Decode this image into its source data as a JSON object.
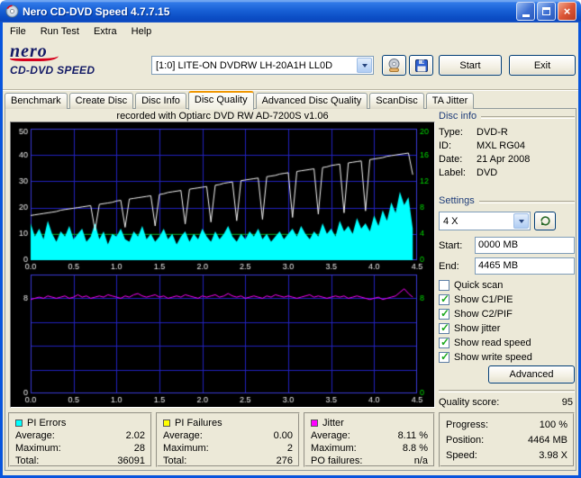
{
  "window": {
    "title": "Nero CD-DVD Speed 4.7.7.15"
  },
  "icons": {
    "close": "×",
    "minimize": "underscore-bar",
    "maximize": "square",
    "dropdown-arrow": "▼",
    "check": "✓",
    "disc": "css-disc-shape",
    "save": "css-floppy-shape",
    "reload": "circular-arrow"
  },
  "menu": {
    "items": [
      "File",
      "Run Test",
      "Extra",
      "Help"
    ]
  },
  "header": {
    "logo_line1": "nero",
    "logo_line2": "CD-DVD SPEED",
    "drive_selected": "[1:0]  LITE-ON DVDRW LH-20A1H LL0D",
    "start_button": "Start",
    "exit_button": "Exit"
  },
  "tabs": {
    "items": [
      "Benchmark",
      "Create Disc",
      "Disc Info",
      "Disc Quality",
      "Advanced Disc Quality",
      "ScanDisc",
      "TA Jitter"
    ],
    "selected": "Disc Quality"
  },
  "chart_data": [
    {
      "name": "Disc quality scan",
      "type": "area+line",
      "annotation": "recorded with Optiarc DVD RW AD-7200S  v1.06",
      "xlim": [
        0,
        4.5
      ],
      "x_unit": "GB",
      "x_ticks": [
        "0.0",
        "0.5",
        "1.0",
        "1.5",
        "2.0",
        "2.5",
        "3.0",
        "3.5",
        "4.0",
        "4.5"
      ],
      "x_grid_step": 0.5,
      "grid_y": [
        10,
        20,
        30,
        40
      ],
      "left_axis": {
        "lim": [
          0,
          50
        ],
        "ticks": [
          0,
          10,
          20,
          30,
          40,
          50
        ]
      },
      "right_axis": {
        "lim": [
          0,
          20
        ],
        "ticks": [
          0,
          4,
          8,
          12,
          16,
          20
        ]
      },
      "x": [
        0,
        0.05,
        0.1,
        0.15,
        0.2,
        0.25,
        0.3,
        0.35,
        0.4,
        0.45,
        0.5,
        0.55,
        0.6,
        0.65,
        0.7,
        0.75,
        0.8,
        0.85,
        0.9,
        0.95,
        1,
        1.05,
        1.1,
        1.15,
        1.2,
        1.25,
        1.3,
        1.35,
        1.4,
        1.45,
        1.5,
        1.55,
        1.6,
        1.65,
        1.7,
        1.75,
        1.8,
        1.85,
        1.9,
        1.95,
        2,
        2.05,
        2.1,
        2.15,
        2.2,
        2.25,
        2.3,
        2.35,
        2.4,
        2.45,
        2.5,
        2.55,
        2.6,
        2.65,
        2.7,
        2.75,
        2.8,
        2.85,
        2.9,
        2.95,
        3,
        3.05,
        3.1,
        3.15,
        3.2,
        3.25,
        3.3,
        3.35,
        3.4,
        3.45,
        3.5,
        3.55,
        3.6,
        3.65,
        3.7,
        3.75,
        3.8,
        3.85,
        3.9,
        3.95,
        4,
        4.05,
        4.1,
        4.15,
        4.2,
        4.25,
        4.3,
        4.35,
        4.4,
        4.45
      ],
      "series": [
        {
          "name": "Read speed",
          "type": "line",
          "axis": "right",
          "color": "#00B400",
          "constant": 4
        },
        {
          "name": "PI Errors",
          "type": "area",
          "axis": "left",
          "color": "#00FFFF",
          "values": [
            14,
            9,
            12,
            8,
            15,
            10,
            7,
            11,
            9,
            13,
            8,
            10,
            12,
            7,
            9,
            14,
            8,
            11,
            6,
            10,
            9,
            12,
            8,
            7,
            11,
            9,
            13,
            8,
            10,
            7,
            9,
            12,
            8,
            10,
            6,
            9,
            11,
            7,
            10,
            8,
            12,
            9,
            7,
            11,
            8,
            10,
            13,
            9,
            7,
            10,
            8,
            11,
            9,
            12,
            8,
            10,
            7,
            9,
            11,
            8,
            10,
            12,
            9,
            13,
            10,
            8,
            11,
            9,
            14,
            10,
            12,
            9,
            15,
            11,
            13,
            10,
            16,
            12,
            14,
            11,
            17,
            13,
            19,
            15,
            22,
            18,
            26,
            21,
            24,
            12
          ]
        },
        {
          "name": "Write speed",
          "type": "line",
          "axis": "right",
          "color": "#F5F5F5",
          "values": [
            6.8,
            6.9,
            7,
            7.1,
            7.2,
            7.3,
            7.4,
            7.6,
            7.7,
            7.8,
            7.9,
            8,
            8.1,
            8.2,
            8.3,
            4.5,
            8.5,
            8.6,
            8.7,
            8.8,
            9,
            9.1,
            5,
            9.3,
            9.4,
            9.5,
            9.6,
            9.7,
            9.8,
            5.2,
            10,
            10.1,
            10.3,
            10.4,
            10.5,
            10.6,
            5.5,
            10.8,
            10.9,
            11,
            11.1,
            11.2,
            5.8,
            11.4,
            11.5,
            11.7,
            11.8,
            11.9,
            6,
            12.1,
            12.2,
            12.3,
            12.4,
            12.5,
            6.2,
            12.7,
            12.8,
            12.9,
            13.1,
            13.2,
            13.3,
            6.5,
            13.5,
            13.6,
            13.7,
            13.8,
            13.9,
            7,
            14.1,
            14.2,
            14.4,
            14.5,
            14.6,
            7.2,
            14.8,
            14.9,
            15,
            15.1,
            7.5,
            15.3,
            15.4,
            15.5,
            15.6,
            15.8,
            15.9,
            16,
            16.1,
            16.2,
            16.3,
            13
          ]
        }
      ]
    },
    {
      "name": "Jitter",
      "type": "line",
      "xlim": [
        0,
        4.5
      ],
      "x_unit": "GB",
      "x_ticks": [
        "0.0",
        "0.5",
        "1.0",
        "1.5",
        "2.0",
        "2.5",
        "3.0",
        "3.5",
        "4.0",
        "4.5"
      ],
      "x_grid_step": 0.5,
      "grid_y": [
        2,
        4,
        6,
        8
      ],
      "left_axis": {
        "lim": [
          0,
          10
        ],
        "ticks": [
          0,
          8
        ]
      },
      "right_axis": {
        "lim": [
          0,
          10
        ],
        "ticks": [
          0,
          8
        ]
      },
      "x": [
        0,
        0.05,
        0.1,
        0.15,
        0.2,
        0.25,
        0.3,
        0.35,
        0.4,
        0.45,
        0.5,
        0.55,
        0.6,
        0.65,
        0.7,
        0.75,
        0.8,
        0.85,
        0.9,
        0.95,
        1,
        1.05,
        1.1,
        1.15,
        1.2,
        1.25,
        1.3,
        1.35,
        1.4,
        1.45,
        1.5,
        1.55,
        1.6,
        1.65,
        1.7,
        1.75,
        1.8,
        1.85,
        1.9,
        1.95,
        2,
        2.05,
        2.1,
        2.15,
        2.2,
        2.25,
        2.3,
        2.35,
        2.4,
        2.45,
        2.5,
        2.55,
        2.6,
        2.65,
        2.7,
        2.75,
        2.8,
        2.85,
        2.9,
        2.95,
        3,
        3.05,
        3.1,
        3.15,
        3.2,
        3.25,
        3.3,
        3.35,
        3.4,
        3.45,
        3.5,
        3.55,
        3.6,
        3.65,
        3.7,
        3.75,
        3.8,
        3.85,
        3.9,
        3.95,
        4,
        4.05,
        4.1,
        4.15,
        4.2,
        4.25,
        4.3,
        4.35,
        4.4,
        4.45
      ],
      "series": [
        {
          "name": "Jitter",
          "type": "line",
          "axis": "left",
          "color": "#FF00FF",
          "values": [
            7.9,
            8,
            8.1,
            8,
            8.2,
            8.1,
            8,
            8.1,
            8.2,
            8,
            8.1,
            8.3,
            8.1,
            8.2,
            8,
            8.1,
            8.2,
            8.1,
            8.3,
            8.2,
            8.1,
            8,
            8.2,
            8.1,
            8.3,
            8.4,
            8.2,
            8.1,
            8.2,
            8.3,
            8.1,
            8.2,
            8,
            8.1,
            8.2,
            8.1,
            8.3,
            8.2,
            8.1,
            8,
            8.2,
            8.1,
            8.2,
            8.3,
            8.1,
            8.2,
            8.4,
            8.2,
            8.1,
            8.2,
            8,
            8.1,
            8.2,
            8.1,
            8,
            8.2,
            8.1,
            8.3,
            8.2,
            8.1,
            8.2,
            8.1,
            8,
            8.1,
            8.2,
            8.3,
            8.1,
            8.2,
            8.1,
            8,
            8.1,
            8.2,
            8.1,
            8.2,
            8,
            8.1,
            8.2,
            8.1,
            8,
            7.9,
            8,
            8.1,
            7.9,
            8,
            8.1,
            8.2,
            8.5,
            8.8,
            8.4,
            8.1
          ]
        }
      ]
    }
  ],
  "disc_info": {
    "title": "Disc info",
    "rows": [
      {
        "label": "Type:",
        "value": "DVD-R"
      },
      {
        "label": "ID:",
        "value": "MXL RG04"
      },
      {
        "label": "Date:",
        "value": "21 Apr 2008"
      },
      {
        "label": "Label:",
        "value": "DVD"
      }
    ]
  },
  "settings": {
    "title": "Settings",
    "speed": "4 X",
    "start_label": "Start:",
    "start_value": "0000 MB",
    "end_label": "End:",
    "end_value": "4465 MB",
    "checkboxes": [
      {
        "label": "Quick scan",
        "checked": false
      },
      {
        "label": "Show C1/PIE",
        "checked": true
      },
      {
        "label": "Show C2/PIF",
        "checked": true
      },
      {
        "label": "Show jitter",
        "checked": true
      },
      {
        "label": "Show read speed",
        "checked": true
      },
      {
        "label": "Show write speed",
        "checked": true
      }
    ],
    "advanced_button": "Advanced"
  },
  "quality": {
    "label": "Quality score:",
    "value": "95"
  },
  "stats": {
    "groups": [
      {
        "title": "PI Errors",
        "color": "#00FFFF",
        "rows": [
          {
            "label": "Average:",
            "value": "2.02"
          },
          {
            "label": "Maximum:",
            "value": "28"
          },
          {
            "label": "Total:",
            "value": "36091"
          }
        ]
      },
      {
        "title": "PI Failures",
        "color": "#FFFF00",
        "rows": [
          {
            "label": "Average:",
            "value": "0.00"
          },
          {
            "label": "Maximum:",
            "value": "2"
          },
          {
            "label": "Total:",
            "value": "276"
          }
        ]
      },
      {
        "title": "Jitter",
        "color": "#FF00FF",
        "rows": [
          {
            "label": "Average:",
            "value": "8.11 %"
          },
          {
            "label": "Maximum:",
            "value": "8.8 %"
          },
          {
            "label": "PO failures:",
            "value": "n/a"
          }
        ]
      }
    ]
  },
  "progress_panel": {
    "rows": [
      {
        "label": "Progress:",
        "value": "100 %"
      },
      {
        "label": "Position:",
        "value": "4464 MB"
      },
      {
        "label": "Speed:",
        "value": "3.98 X"
      }
    ]
  }
}
